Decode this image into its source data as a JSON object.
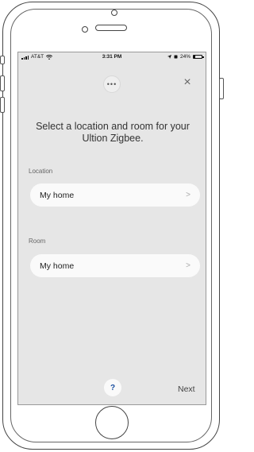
{
  "status_bar": {
    "carrier": "AT&T",
    "time": "3:31 PM",
    "battery": "24%"
  },
  "header": {
    "more_icon": "ellipsis-icon",
    "close_icon": "close-icon"
  },
  "title": "Select a location and room for your Ultion Zigbee.",
  "location": {
    "section_label": "Location",
    "value": "My home"
  },
  "room": {
    "section_label": "Room",
    "value": "My home"
  },
  "footer": {
    "help_label": "?",
    "next_label": "Next"
  },
  "colors": {
    "screen_background": "#e6e6e6",
    "row_background": "#fafafa",
    "help_accent": "#1a4fa0"
  }
}
